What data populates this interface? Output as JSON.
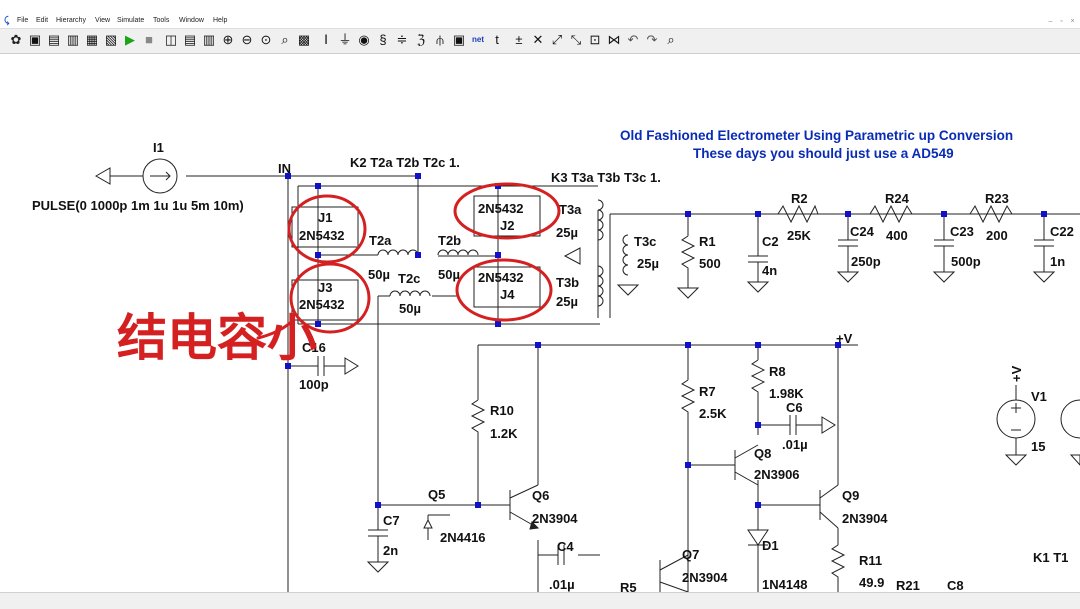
{
  "app": {
    "logo_icon": "ltspice-logo-icon"
  },
  "menu": [
    "File",
    "Edit",
    "Hierarchy",
    "View",
    "Simulate",
    "Tools",
    "Window",
    "Help"
  ],
  "toolbar": {
    "icons": [
      "settings-icon",
      "open-icon",
      "save-icon",
      "save-all-icon",
      "print-icon",
      "control-panel-icon",
      "run-icon",
      "halt-icon",
      "tile-horizontal-icon",
      "tile-vertical-icon",
      "cascade-icon",
      "zoom-in-icon",
      "zoom-out-icon",
      "zoom-fit-icon",
      "zoom-area-icon",
      "autoscale-icon",
      "wire-icon",
      "ground-icon",
      "label-icon",
      "resistor-icon",
      "capacitor-icon",
      "inductor-icon",
      "diode-icon",
      "component-icon",
      "spice-directive-icon",
      "text-icon",
      "move-icon",
      "delete-icon",
      "duplicate-icon",
      "drag-icon",
      "mirror-icon",
      "rotate-icon",
      "undo-icon",
      "redo-icon",
      "find-icon"
    ],
    "glyphs": [
      "✿",
      "▣",
      "▤",
      "▥",
      "▦",
      "▧",
      "▶",
      "■",
      "◫",
      "▤",
      "▥",
      "⊕",
      "⊖",
      "⊙",
      "⌕",
      "▩",
      "Ⅰ",
      "⏚",
      "◉",
      "§",
      "≑",
      "ℨ",
      "⫛",
      "▣",
      "net",
      "t",
      "±",
      "✕",
      "⤢",
      "⤡",
      "⊡",
      "⋈",
      "↶",
      "↷",
      "⌕"
    ]
  },
  "annotation": {
    "text": "结电容小",
    "color": "#d42020"
  },
  "schematic": {
    "title_line1": "Old Fashioned Electrometer Using Parametric up Conversion",
    "title_line2": "These days you should just use a AD549",
    "title_color": "#0a2cb4",
    "k2": "K2 T2a T2b T2c 1.",
    "k3": "K3 T3a T3b T3c 1.",
    "k1": "K1 T1",
    "labels": {
      "in_net": "IN",
      "vplus_net": "+V",
      "i1": "I1",
      "i1_value": "PULSE(0 1000p 1m 1u 1u 5m 10m)",
      "j1": "J1",
      "j1_model": "2N5432",
      "j2": "J2",
      "j2_model": "2N5432",
      "j3": "J3",
      "j3_model": "2N5432",
      "j4": "J4",
      "j4_model": "2N5432",
      "t2a": "T2a",
      "t2a_value": "50µ",
      "t2b": "T2b",
      "t2b_value": "50µ",
      "t2c": "T2c",
      "t2c_value": "50µ",
      "t3a": "T3a",
      "t3a_value": "25µ",
      "t3b": "T3b",
      "t3b_value": "25µ",
      "t3c": "T3c",
      "t3c_value": "25µ",
      "r1": "R1",
      "r1_value": "500",
      "c2": "C2",
      "c2_value": "4n",
      "r2": "R2",
      "r2_value": "25K",
      "c24": "C24",
      "c24_value": "250p",
      "r24": "R24",
      "r24_value": "400",
      "c23": "C23",
      "c23_value": "500p",
      "r23": "R23",
      "r23_value": "200",
      "c22": "C22",
      "c22_value": "1n",
      "c16": "C16",
      "c16_value": "100p",
      "r10": "R10",
      "r10_value": "1.2K",
      "r7": "R7",
      "r7_value": "2.5K",
      "r8": "R8",
      "r8_value": "1.98K",
      "c6": "C6",
      "c6_value": ".01µ",
      "q8": "Q8",
      "q8_model": "2N3906",
      "q5": "Q5",
      "q5_model": "2N4416",
      "q6": "Q6",
      "q6_model": "2N3904",
      "q9": "Q9",
      "q9_model": "2N3904",
      "q7": "Q7",
      "q7_model": "2N3904",
      "c7": "C7",
      "c7_value": "2n",
      "c4": "C4",
      "c4_value": ".01µ",
      "d1": "D1",
      "d1_model": "1N4148",
      "r11": "R11",
      "r11_value": "49.9",
      "r21": "R21",
      "c8": "C8",
      "r5": "R5",
      "v1": "V1",
      "v1_value": "15",
      "v1_net": "+V"
    }
  }
}
